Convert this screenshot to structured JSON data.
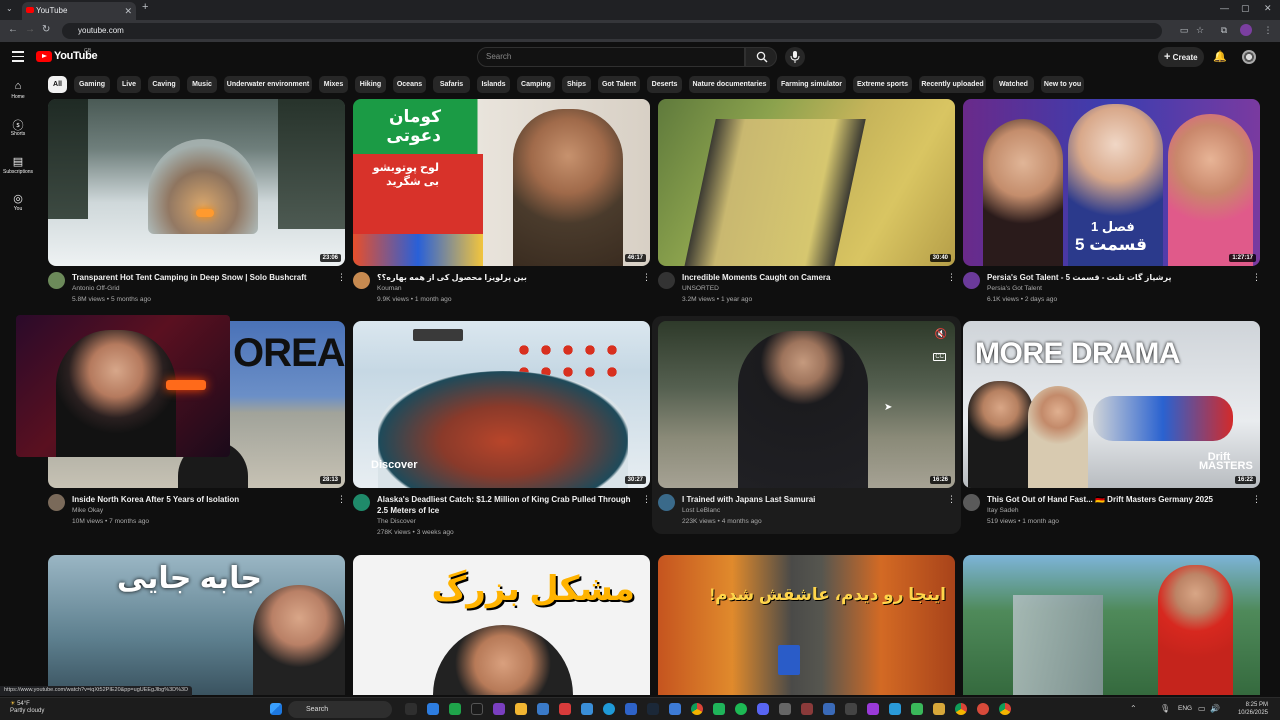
{
  "browser": {
    "tab_title": "YouTube",
    "url": "youtube.com",
    "status_url": "https://www.youtube.com/watch?v=iqXt52PIE20&pp=ugUEEgJlbg%3D%3D"
  },
  "header": {
    "logo_text": "YouTube",
    "logo_region": "GB",
    "search_placeholder": "Search",
    "create_label": "Create"
  },
  "left_nav": [
    {
      "label": "Home",
      "icon": "home-icon"
    },
    {
      "label": "Shorts",
      "icon": "shorts-icon"
    },
    {
      "label": "Subscriptions",
      "icon": "subscriptions-icon"
    },
    {
      "label": "You",
      "icon": "you-icon"
    }
  ],
  "chips": [
    "All",
    "Gaming",
    "Live",
    "Caving",
    "Music",
    "Underwater environment",
    "Mixes",
    "Hiking",
    "Oceans",
    "Safaris",
    "Islands",
    "Camping",
    "Ships",
    "Got Talent",
    "Deserts",
    "Nature documentaries",
    "Farming simulator",
    "Extreme sports",
    "Recently uploaded",
    "Watched",
    "New to you"
  ],
  "videos": [
    {
      "title": "Transparent Hot Tent Camping in Deep Snow | Solo Bushcraft",
      "channel": "Antonio Off-Grid",
      "meta": "5.8M views • 5 months ago",
      "duration": "23:06"
    },
    {
      "title": "بین پرلویزا محصول کی از همه بهاره؟؟",
      "channel": "Kouman",
      "meta": "9.9K views • 1 month ago",
      "duration": "46:17"
    },
    {
      "title": "Incredible Moments Caught on Camera",
      "channel": "UNSORTED",
      "meta": "3.2M views • 1 year ago",
      "duration": "30:40"
    },
    {
      "title": "Persia's Got Talent - 5 پرشیاز گات تلنت - قسمت",
      "channel": "Persia's Got Talent",
      "meta": "6.1K views • 2 days ago",
      "duration": "1:27:17"
    },
    {
      "title": "Inside North Korea After 5 Years of Isolation",
      "channel": "Mike Okay",
      "meta": "10M views • 7 months ago",
      "duration": "28:13"
    },
    {
      "title": "Alaska's Deadliest Catch: $1.2 Million of King Crab Pulled Through 2.5 Meters of Ice",
      "channel": "The Discover",
      "meta": "278K views • 3 weeks ago",
      "duration": "30:27"
    },
    {
      "title": "I Trained with Japans Last Samurai",
      "channel": "Lost LeBlanc",
      "meta": "223K views • 4 months ago",
      "duration": "16:26"
    },
    {
      "title": "This Got Out of Hand Fast... 🇩🇪 Drift Masters Germany 2025",
      "channel": "Itay Sadeh",
      "meta": "519 views • 1 month ago",
      "duration": "16:22"
    }
  ],
  "thumb_text": {
    "v2": "كومان دعوتی",
    "v2b": "لوح پوتوبشو بی شگرید",
    "v4a": "فصل 1",
    "v4b": "قسمت 5",
    "v5": "OREA",
    "v6": "Discover",
    "v8a": "MORE DRAMA",
    "v8b": "Drift MASTERS",
    "r3a": "جابه جایی",
    "r3b": "مشکل بزرگ",
    "r3c": "اینجا رو دیدم، عاشقش شدم!"
  },
  "taskbar": {
    "weather_temp": "54°F",
    "weather_desc": "Partly cloudy",
    "search": "Search",
    "lang": "ENG",
    "time": "8:25 PM",
    "date": "10/26/2025"
  }
}
